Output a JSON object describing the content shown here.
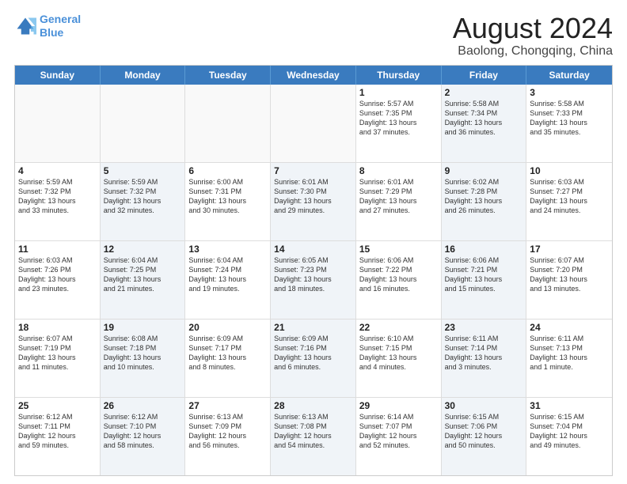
{
  "logo": {
    "line1": "General",
    "line2": "Blue"
  },
  "title": "August 2024",
  "location": "Baolong, Chongqing, China",
  "headers": [
    "Sunday",
    "Monday",
    "Tuesday",
    "Wednesday",
    "Thursday",
    "Friday",
    "Saturday"
  ],
  "rows": [
    [
      {
        "day": "",
        "text": "",
        "empty": true
      },
      {
        "day": "",
        "text": "",
        "empty": true
      },
      {
        "day": "",
        "text": "",
        "empty": true
      },
      {
        "day": "",
        "text": "",
        "empty": true
      },
      {
        "day": "1",
        "text": "Sunrise: 5:57 AM\nSunset: 7:35 PM\nDaylight: 13 hours\nand 37 minutes."
      },
      {
        "day": "2",
        "text": "Sunrise: 5:58 AM\nSunset: 7:34 PM\nDaylight: 13 hours\nand 36 minutes.",
        "shaded": true
      },
      {
        "day": "3",
        "text": "Sunrise: 5:58 AM\nSunset: 7:33 PM\nDaylight: 13 hours\nand 35 minutes."
      }
    ],
    [
      {
        "day": "4",
        "text": "Sunrise: 5:59 AM\nSunset: 7:32 PM\nDaylight: 13 hours\nand 33 minutes."
      },
      {
        "day": "5",
        "text": "Sunrise: 5:59 AM\nSunset: 7:32 PM\nDaylight: 13 hours\nand 32 minutes.",
        "shaded": true
      },
      {
        "day": "6",
        "text": "Sunrise: 6:00 AM\nSunset: 7:31 PM\nDaylight: 13 hours\nand 30 minutes."
      },
      {
        "day": "7",
        "text": "Sunrise: 6:01 AM\nSunset: 7:30 PM\nDaylight: 13 hours\nand 29 minutes.",
        "shaded": true
      },
      {
        "day": "8",
        "text": "Sunrise: 6:01 AM\nSunset: 7:29 PM\nDaylight: 13 hours\nand 27 minutes."
      },
      {
        "day": "9",
        "text": "Sunrise: 6:02 AM\nSunset: 7:28 PM\nDaylight: 13 hours\nand 26 minutes.",
        "shaded": true
      },
      {
        "day": "10",
        "text": "Sunrise: 6:03 AM\nSunset: 7:27 PM\nDaylight: 13 hours\nand 24 minutes."
      }
    ],
    [
      {
        "day": "11",
        "text": "Sunrise: 6:03 AM\nSunset: 7:26 PM\nDaylight: 13 hours\nand 23 minutes."
      },
      {
        "day": "12",
        "text": "Sunrise: 6:04 AM\nSunset: 7:25 PM\nDaylight: 13 hours\nand 21 minutes.",
        "shaded": true
      },
      {
        "day": "13",
        "text": "Sunrise: 6:04 AM\nSunset: 7:24 PM\nDaylight: 13 hours\nand 19 minutes."
      },
      {
        "day": "14",
        "text": "Sunrise: 6:05 AM\nSunset: 7:23 PM\nDaylight: 13 hours\nand 18 minutes.",
        "shaded": true
      },
      {
        "day": "15",
        "text": "Sunrise: 6:06 AM\nSunset: 7:22 PM\nDaylight: 13 hours\nand 16 minutes."
      },
      {
        "day": "16",
        "text": "Sunrise: 6:06 AM\nSunset: 7:21 PM\nDaylight: 13 hours\nand 15 minutes.",
        "shaded": true
      },
      {
        "day": "17",
        "text": "Sunrise: 6:07 AM\nSunset: 7:20 PM\nDaylight: 13 hours\nand 13 minutes."
      }
    ],
    [
      {
        "day": "18",
        "text": "Sunrise: 6:07 AM\nSunset: 7:19 PM\nDaylight: 13 hours\nand 11 minutes."
      },
      {
        "day": "19",
        "text": "Sunrise: 6:08 AM\nSunset: 7:18 PM\nDaylight: 13 hours\nand 10 minutes.",
        "shaded": true
      },
      {
        "day": "20",
        "text": "Sunrise: 6:09 AM\nSunset: 7:17 PM\nDaylight: 13 hours\nand 8 minutes."
      },
      {
        "day": "21",
        "text": "Sunrise: 6:09 AM\nSunset: 7:16 PM\nDaylight: 13 hours\nand 6 minutes.",
        "shaded": true
      },
      {
        "day": "22",
        "text": "Sunrise: 6:10 AM\nSunset: 7:15 PM\nDaylight: 13 hours\nand 4 minutes."
      },
      {
        "day": "23",
        "text": "Sunrise: 6:11 AM\nSunset: 7:14 PM\nDaylight: 13 hours\nand 3 minutes.",
        "shaded": true
      },
      {
        "day": "24",
        "text": "Sunrise: 6:11 AM\nSunset: 7:13 PM\nDaylight: 13 hours\nand 1 minute."
      }
    ],
    [
      {
        "day": "25",
        "text": "Sunrise: 6:12 AM\nSunset: 7:11 PM\nDaylight: 12 hours\nand 59 minutes."
      },
      {
        "day": "26",
        "text": "Sunrise: 6:12 AM\nSunset: 7:10 PM\nDaylight: 12 hours\nand 58 minutes.",
        "shaded": true
      },
      {
        "day": "27",
        "text": "Sunrise: 6:13 AM\nSunset: 7:09 PM\nDaylight: 12 hours\nand 56 minutes."
      },
      {
        "day": "28",
        "text": "Sunrise: 6:13 AM\nSunset: 7:08 PM\nDaylight: 12 hours\nand 54 minutes.",
        "shaded": true
      },
      {
        "day": "29",
        "text": "Sunrise: 6:14 AM\nSunset: 7:07 PM\nDaylight: 12 hours\nand 52 minutes."
      },
      {
        "day": "30",
        "text": "Sunrise: 6:15 AM\nSunset: 7:06 PM\nDaylight: 12 hours\nand 50 minutes.",
        "shaded": true
      },
      {
        "day": "31",
        "text": "Sunrise: 6:15 AM\nSunset: 7:04 PM\nDaylight: 12 hours\nand 49 minutes."
      }
    ]
  ]
}
